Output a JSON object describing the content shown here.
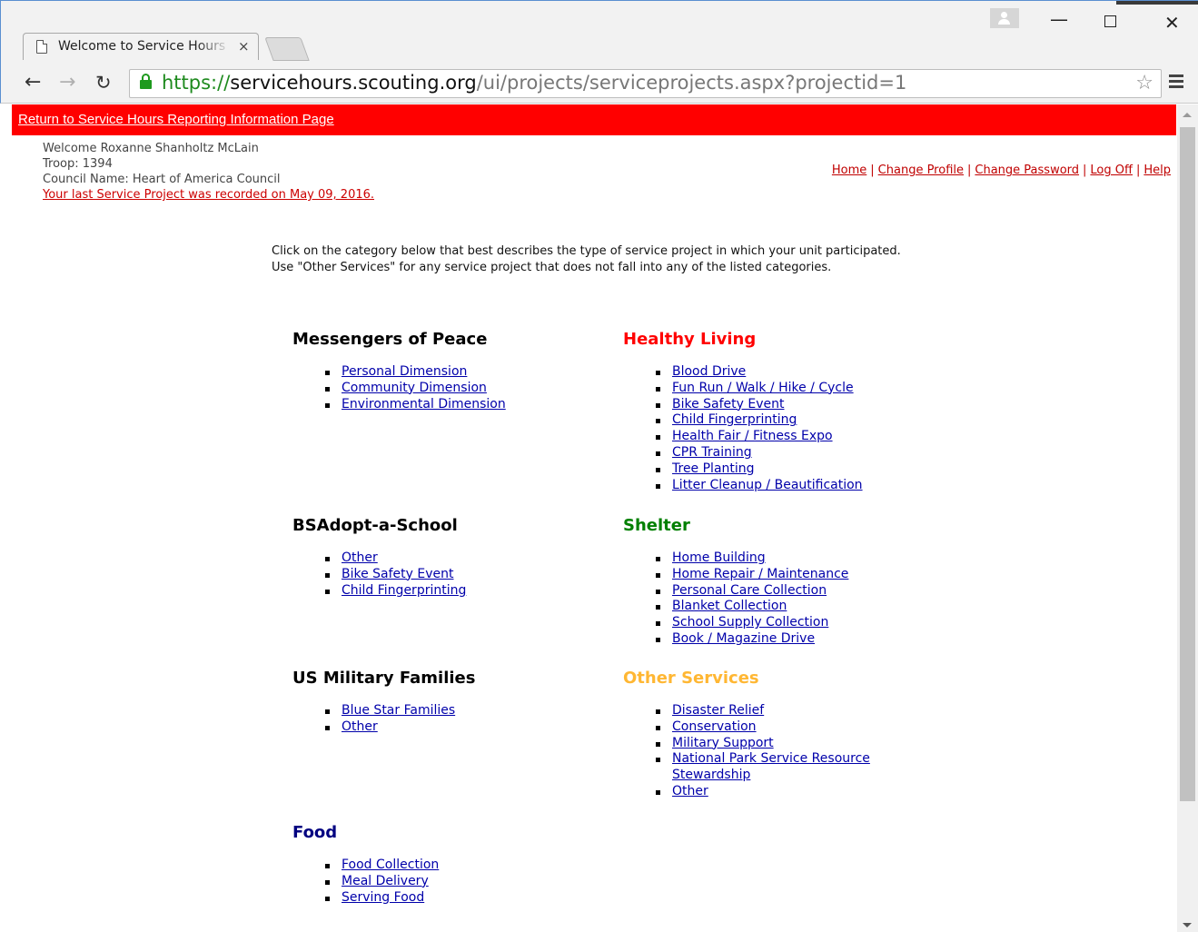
{
  "browser": {
    "tab_title": "Welcome to Service Hours Reporting",
    "tab_close": "×",
    "url_scheme": "https://",
    "url_host": "servicehours.scouting.org",
    "url_path": "/ui/projects/serviceprojects.aspx?projectid=1",
    "win_min": "—",
    "win_close": "✕"
  },
  "banner": {
    "link": "Return to Service Hours Reporting Information Page",
    "color": "#ff0000"
  },
  "user": {
    "welcome": "Welcome Roxanne Shanholtz McLain",
    "troop": "Troop: 1394",
    "council": "Council Name: Heart of America Council",
    "last_project": "Your last Service Project was recorded on May 09, 2016."
  },
  "top_links": {
    "home": "Home",
    "profile": "Change Profile",
    "password": "Change Password",
    "logoff": "Log Off",
    "help": "Help",
    "separator": "|"
  },
  "intro": "Click on the category below that best describes the type of service project in which your unit participated. Use \"Other Services\" for any service project that does not fall into any of the listed categories.",
  "categories": {
    "messengers": {
      "title": "Messengers of Peace",
      "color": "#000000",
      "items": [
        "Personal Dimension",
        "Community Dimension",
        "Environmental Dimension"
      ]
    },
    "healthy": {
      "title": "Healthy Living",
      "color": "#ff0000",
      "items": [
        "Blood Drive",
        "Fun Run / Walk / Hike / Cycle",
        "Bike Safety Event",
        "Child Fingerprinting",
        "Health Fair / Fitness Expo",
        "CPR Training",
        "Tree Planting",
        "Litter Cleanup / Beautification"
      ]
    },
    "school": {
      "title": "BSAdopt-a-School",
      "color": "#000000",
      "items": [
        "Other",
        "Bike Safety Event",
        "Child Fingerprinting"
      ]
    },
    "shelter": {
      "title": "Shelter",
      "color": "#008000",
      "items": [
        "Home Building",
        "Home Repair / Maintenance",
        "Personal Care Collection",
        "Blanket Collection",
        "School Supply Collection",
        "Book / Magazine Drive"
      ]
    },
    "military": {
      "title": "US Military Families",
      "color": "#000000",
      "items": [
        "Blue Star Families",
        "Other"
      ]
    },
    "other": {
      "title": "Other Services",
      "color": "#ffb733",
      "items": [
        "Disaster Relief",
        "Conservation",
        "Military Support",
        "National Park Service Resource Stewardship",
        "Other"
      ]
    },
    "food": {
      "title": "Food",
      "color": "#000080",
      "items": [
        "Food Collection",
        "Meal Delivery",
        "Serving Food"
      ]
    }
  }
}
